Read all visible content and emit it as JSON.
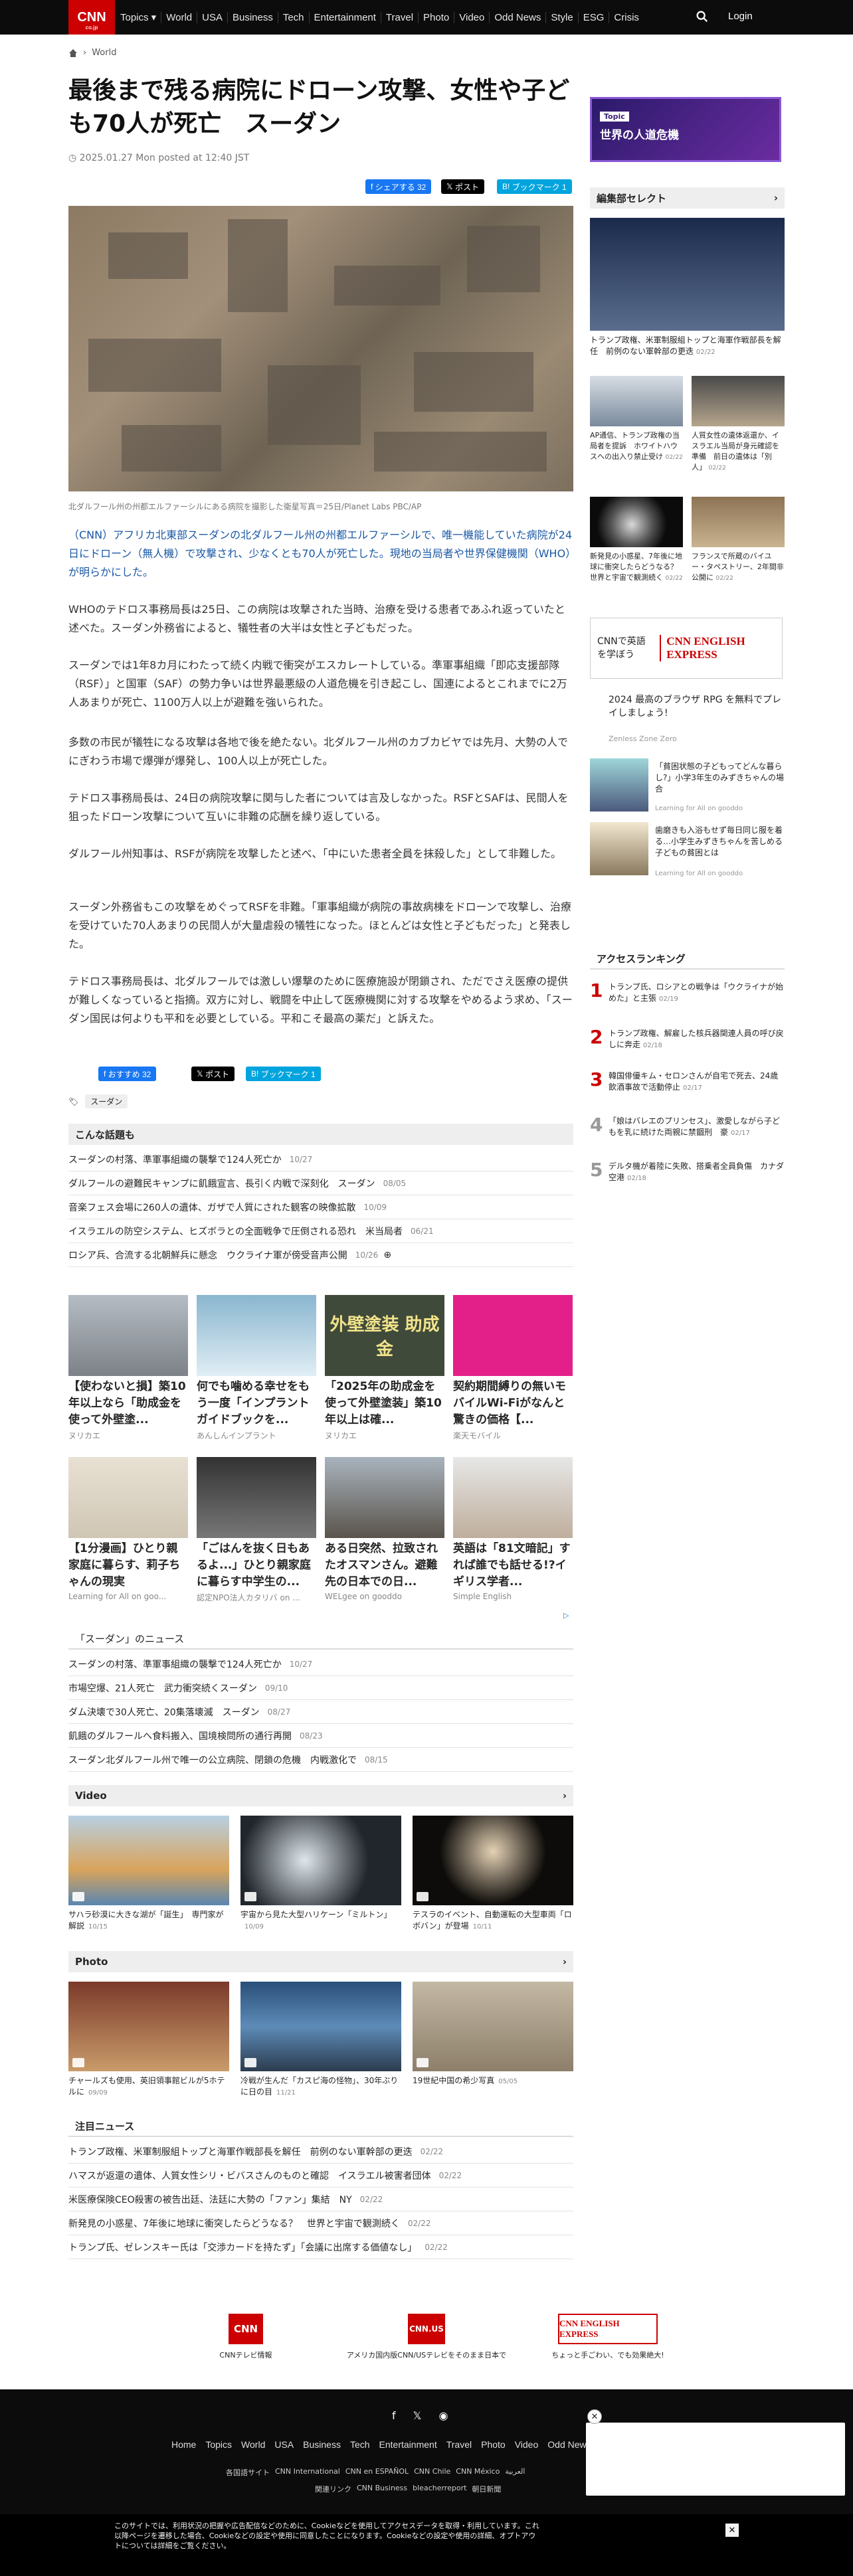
{
  "header": {
    "logo": "CNN",
    "logo_sub": "co.jp",
    "nav": [
      "Topics ▾",
      "World",
      "USA",
      "Business",
      "Tech",
      "Entertainment",
      "Travel",
      "Photo",
      "Video",
      "Odd News",
      "Style",
      "ESG",
      "Crisis"
    ],
    "login": "Login"
  },
  "breadcrumb": {
    "section": "World"
  },
  "article": {
    "title": "最後まで残る病院にドローン攻撃、女性や子ども70人が死亡　スーダン",
    "date": "2025.01.27 Mon posted at 12:40 JST",
    "share_fb": "シェアする 32",
    "share_x": "ポスト",
    "share_hb": "ブックマーク 1",
    "caption": "北ダルフール州の州都エルファーシルにある病院を撮影した衛星写真＝25日/Planet Labs PBC/AP",
    "paragraphs": [
      "（CNN）アフリカ北東部スーダンの北ダルフール州の州都エルファーシルで、唯一機能していた病院が24日にドローン（無人機）で攻撃され、少なくとも70人が死亡した。現地の当局者や世界保健機関（WHO）が明らかにした。",
      "WHOのテドロス事務局長は25日、この病院は攻撃された当時、治療を受ける患者であふれ返っていたと述べた。スーダン外務省によると、犠牲者の大半は女性と子どもだった。",
      "スーダンでは1年8カ月にわたって続く内戦で衝突がエスカレートしている。準軍事組織「即応支援部隊（RSF）」と国軍（SAF）の勢力争いは世界最悪級の人道危機を引き起こし、国連によるとこれまでに2万人あまりが死亡、1100万人以上が避難を強いられた。",
      "多数の市民が犠牲になる攻撃は各地で後を絶たない。北ダルフール州のカブカビヤでは先月、大勢の人でにぎわう市場で爆弾が爆発し、100人以上が死亡した。",
      "テドロス事務局長は、24日の病院攻撃に関与した者については言及しなかった。RSFとSAFは、民間人を狙ったドローン攻撃について互いに非難の応酬を繰り返している。",
      "ダルフール州知事は、RSFが病院を攻撃したと述べ、「中にいた患者全員を抹殺した」として非難した。",
      "スーダン外務省もこの攻撃をめぐってRSFを非難。「軍事組織が病院の事故病棟をドローンで攻撃し、治療を受けていた70人あまりの民間人が大量虐殺の犠牲になった。ほとんどは女性と子どもだった」と発表した。",
      "テドロス事務局長は、北ダルフールでは激しい爆撃のために医療施設が閉鎖され、ただでさえ医療の提供が難しくなっていると指摘。双方に対し、戦闘を中止して医療機関に対する攻撃をやめるよう求め、「スーダン国民は何よりも平和を必要としている。平和こそ最高の薬だ」と訴えた。"
    ],
    "bottom_fb": "おすすめ 32",
    "bottom_x": "ポスト",
    "bottom_hb": "ブックマーク 1",
    "tag": "スーダン"
  },
  "related": {
    "heading": "こんな話題も",
    "items": [
      {
        "t": "スーダンの村落、準軍事組織の襲撃で124人死亡か",
        "d": "10/27"
      },
      {
        "t": "ダルフールの避難民キャンプに飢餓宣言、長引く内戦で深刻化　スーダン",
        "d": "08/05"
      },
      {
        "t": "音楽フェス会場に260人の遺体、ガザで人質にされた観客の映像拡散",
        "d": "10/09"
      },
      {
        "t": "イスラエルの防空システム、ヒズボラとの全面戦争で圧倒される恐れ　米当局者",
        "d": "06/21"
      },
      {
        "t": "ロシア兵、合流する北朝鮮兵に懸念　ウクライナ軍が傍受音声公開",
        "d": "10/26"
      }
    ]
  },
  "promo": [
    {
      "t": "【使わないと損】築10年以上なら「助成金を使って外壁塗...",
      "s": "ヌリカエ"
    },
    {
      "t": "何でも噛める幸せをもう一度「インプラントガイドブックを...",
      "s": "あんしんインプラント"
    },
    {
      "t": "「2025年の助成金を使って外壁塗装」築10年以上は確...",
      "s": "ヌリカエ"
    },
    {
      "t": "契約期間縛りの無いモバイルWi-Fiがなんと驚きの価格【...",
      "s": "楽天モバイル"
    },
    {
      "t": "【1分漫画】ひとり親家庭に暮らす、莉子ちゃんの現実",
      "s": "Learning for All on goo..."
    },
    {
      "t": "「ごはんを抜く日もあるよ...」ひとり親家庭に暮らす中学生の...",
      "s": "認定NPO法人カタリバ on ..."
    },
    {
      "t": "ある日突然、拉致されたオスマンさん。避難先の日本での日...",
      "s": "WELgee on gooddo"
    },
    {
      "t": "英語は「81文暗記」すれば誰でも話せる!?イギリス学者...",
      "s": "Simple English"
    }
  ],
  "promo_img_text": {
    "p3": "外壁塗装 助成金"
  },
  "news": {
    "heading": "「スーダン」のニュース",
    "items": [
      {
        "t": "スーダンの村落、準軍事組織の襲撃で124人死亡か",
        "d": "10/27"
      },
      {
        "t": "市場空爆、21人死亡　武力衝突続くスーダン",
        "d": "09/10"
      },
      {
        "t": "ダム決壊で30人死亡、20集落壊滅　スーダン",
        "d": "08/27"
      },
      {
        "t": "飢餓のダルフールへ食料搬入、国境検問所の通行再開",
        "d": "08/23"
      },
      {
        "t": "スーダン北ダルフール州で唯一の公立病院、閉鎖の危機　内戦激化で",
        "d": "08/15"
      }
    ]
  },
  "video": {
    "heading": "Video",
    "items": [
      {
        "t": "サハラ砂漠に大きな湖が「誕生」　専門家が解説",
        "d": "10/15"
      },
      {
        "t": "宇宙から見た大型ハリケーン「ミルトン」",
        "d": "10/09"
      },
      {
        "t": "テスラのイベント、自動運転の大型車両「ロボバン」が登場",
        "d": "10/11"
      }
    ]
  },
  "photo": {
    "heading": "Photo",
    "items": [
      {
        "t": "チャールズも使用、英旧領事館ビルが5ホテルに",
        "d": "09/09"
      },
      {
        "t": "冷戦が生んだ「カスピ海の怪物」、30年ぶりに日の目",
        "d": "11/21"
      },
      {
        "t": "19世紀中国の希少写真",
        "d": "05/05"
      }
    ]
  },
  "notice": {
    "heading": "注目ニュース",
    "items": [
      {
        "t": "トランプ政権、米軍制服組トップと海軍作戦部長を解任　前例のない軍幹部の更迭",
        "d": "02/22"
      },
      {
        "t": "ハマスが返還の遺体、人質女性シリ・ビバスさんのものと確認　イスラエル被害者団体",
        "d": "02/22"
      },
      {
        "t": "米医療保険CEO殺害の被告出廷、法廷に大勢の「ファン」集結　NY",
        "d": "02/22"
      },
      {
        "t": "新発見の小惑星、7年後に地球に衝突したらどうなる？　世界と宇宙で観測続く",
        "d": "02/22"
      },
      {
        "t": "トランプ氏、ゼレンスキー氏は「交渉カードを持たず」「会議に出席する価値なし」",
        "d": "02/22"
      }
    ]
  },
  "bottom_logos": [
    {
      "name": "CNN",
      "label": "CNNテレビ情報"
    },
    {
      "name": "CNN.US",
      "label": "アメリカ国内版CNN/USテレビをそのまま日本で"
    },
    {
      "name": "CNN ENGLISH EXPRESS",
      "label": "ちょっと手ごわい、でも効果絶大!"
    }
  ],
  "sidebar": {
    "topic_label": "Topic",
    "topic_title": "世界の人道危機",
    "select_heading": "編集部セレクト",
    "main_caption": "トランプ政権、米軍制服組トップと海軍作戦部長を解任　前例のない軍幹部の更迭",
    "main_date": "02/22",
    "cards": [
      {
        "t": "AP通信、トランプ政権の当局者を提訴　ホワイトハウスへの出入り禁止受け",
        "d": "02/22"
      },
      {
        "t": "人質女性の遺体返還か、イスラエル当局が身元確認を準備　前日の遺体は「別人」",
        "d": "02/22"
      },
      {
        "t": "新発見の小惑星、7年後に地球に衝突したらどうなる？　世界と宇宙で観測続く",
        "d": "02/22"
      },
      {
        "t": "フランスで所蔵のバイユー・タペストリー、2年間非公開に",
        "d": "02/22"
      }
    ],
    "ad_text1": "CNNで英語を学ぼう",
    "ad_logo": "CNN ENGLISH EXPRESS",
    "game_t": "2024 最高のブラウザ RPG を無料でプレイしましょう!",
    "game_s": "Zenless Zone Zero",
    "ad2_t": "「貧困状態の子どもってどんな暮らし?」小学3年生のみずきちゃんの場合",
    "ad2_s": "Learning for All on gooddo",
    "ad3_t": "歯磨きも入浴もせず毎日同じ服を着る…小学生みずきちゃんを苦しめる子どもの貧困とは",
    "ad3_s": "Learning for All on gooddo",
    "rank_heading": "アクセスランキング",
    "ranks": [
      {
        "n": "1",
        "t": "トランプ氏、ロシアとの戦争は「ウクライナが始めた」と主張",
        "d": "02/19"
      },
      {
        "n": "2",
        "t": "トランプ政権、解雇した核兵器関連人員の呼び戻しに奔走",
        "d": "02/18"
      },
      {
        "n": "3",
        "t": "韓国俳優キム・セロンさんが自宅で死去、24歳　飲酒事故で活動停止",
        "d": "02/17"
      },
      {
        "n": "4",
        "t": "「娘はバレエのプリンセス」、激愛しながら子どもを乳に続けた両親に禁錮刑　豪",
        "d": "02/17"
      },
      {
        "n": "5",
        "t": "デルタ機が着陸に失敗、搭乗者全員負傷　カナダ空港",
        "d": "02/18"
      }
    ]
  },
  "footer": {
    "nav": [
      "Home",
      "Topics",
      "World",
      "USA",
      "Business",
      "Tech",
      "Entertainment",
      "Travel",
      "Photo",
      "Video",
      "Odd News"
    ],
    "links": [
      "各国語サイト",
      "CNN International",
      "CNN en ESPAÑOL",
      "CNN Chile",
      "CNN México",
      "العربية"
    ],
    "links2": [
      "関連リンク",
      "CNN Business",
      "bleacherreport",
      "朝日新聞"
    ],
    "cookie": "このサイトでは、利用状況の把握や広告配信などのために、Cookieなどを使用してアクセスデータを取得・利用しています。これ以降ページを遷移した場合、Cookieなどの設定や使用に同意したことになります。Cookieなどの設定や使用の詳細、オプトアウトについては詳細をご覧ください。"
  },
  "colors": {
    "cnn_red": "#cc0000",
    "link_blue": "#1a58a5",
    "topic_purple": "#3a1e78"
  }
}
